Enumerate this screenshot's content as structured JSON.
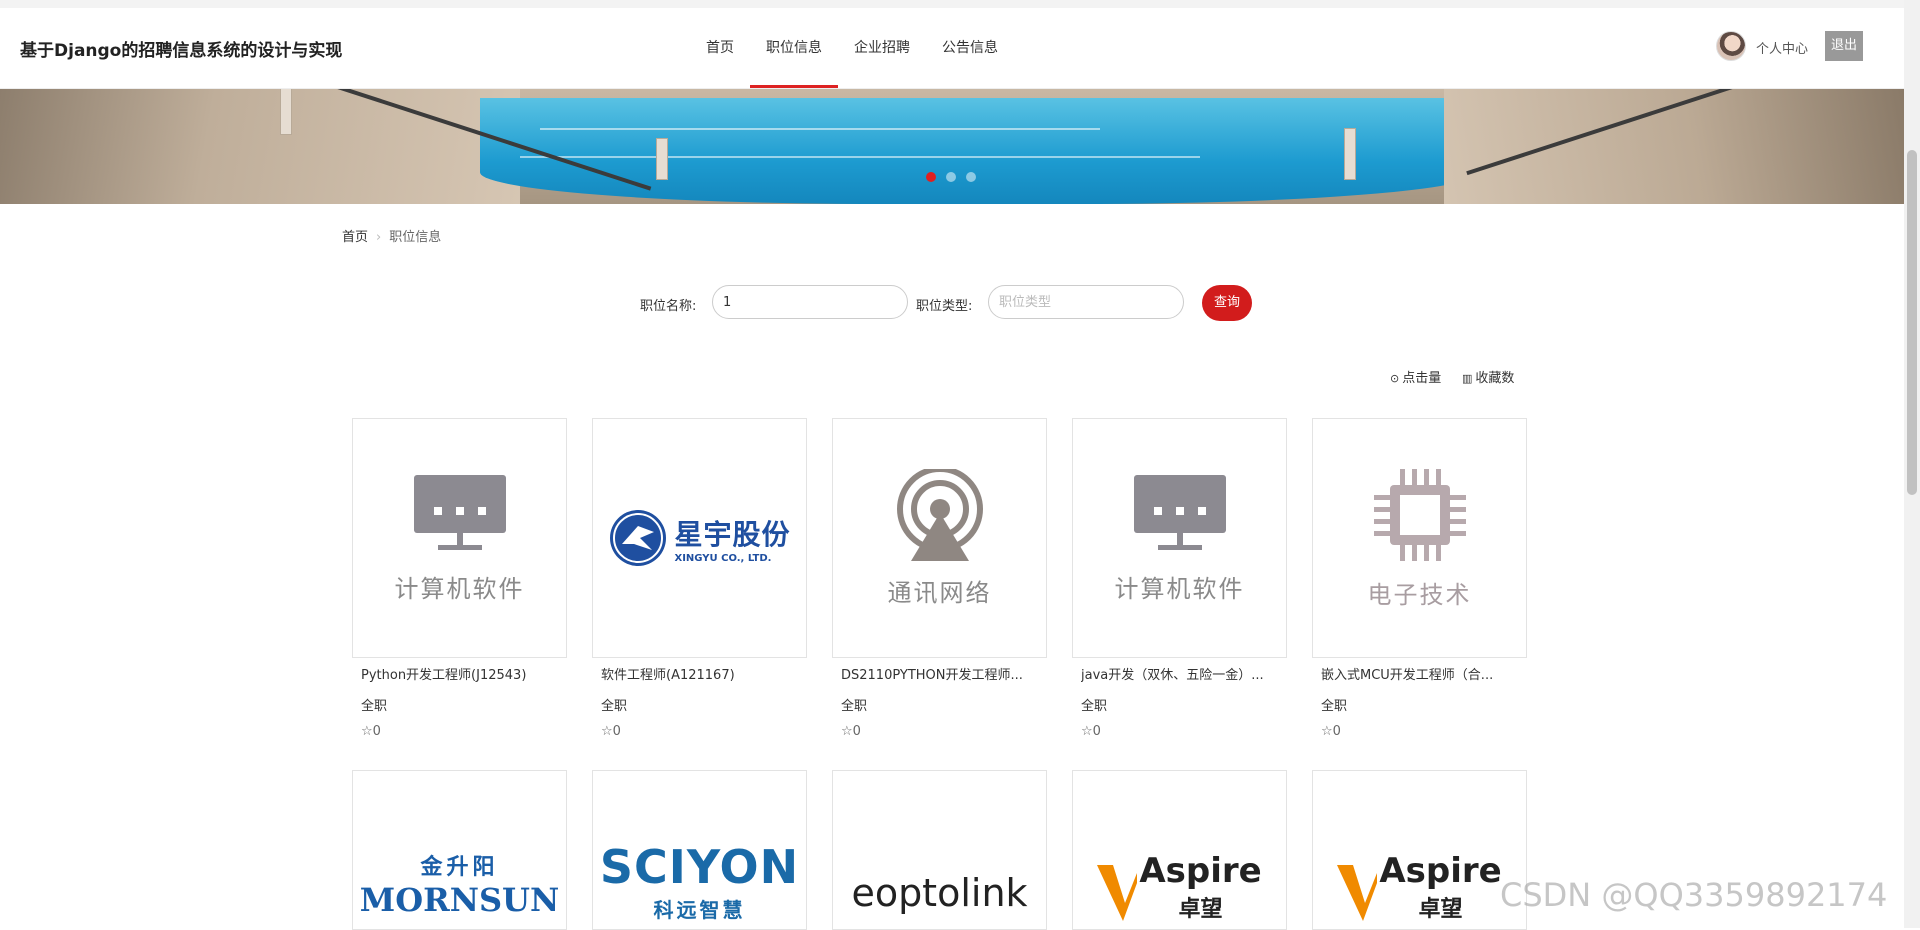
{
  "header": {
    "site_title": "基于Django的招聘信息系统的设计与实现",
    "nav": [
      "首页",
      "职位信息",
      "企业招聘",
      "公告信息"
    ],
    "active_nav": "职位信息",
    "user_center": "个人中心",
    "logout": "退出"
  },
  "breadcrumb": {
    "home": "首页",
    "sep": "›",
    "current": "职位信息"
  },
  "search": {
    "name_label": "职位名称:",
    "name_value": "1",
    "type_label": "职位类型:",
    "type_placeholder": "职位类型",
    "button": "查询"
  },
  "sort": {
    "clicks": "点击量",
    "favorites": "收藏数"
  },
  "jobs": [
    {
      "title": "Python开发工程师(J12543)",
      "type": "全职",
      "favorites": "0",
      "image_label": "计算机软件",
      "icon": "monitor-icon"
    },
    {
      "title": "软件工程师(A121167)",
      "type": "全职",
      "favorites": "0",
      "image_label": "星宇股份",
      "image_sub": "XINGYU CO., LTD.",
      "icon": "xingyu-logo"
    },
    {
      "title": "DS2110PYTHON开发工程师...",
      "type": "全职",
      "favorites": "0",
      "image_label": "通讯网络",
      "icon": "signal-icon"
    },
    {
      "title": "java开发（双休、五险一金）...",
      "type": "全职",
      "favorites": "0",
      "image_label": "计算机软件",
      "icon": "monitor-icon"
    },
    {
      "title": "嵌入式MCU开发工程师（合...",
      "type": "全职",
      "favorites": "0",
      "image_label": "电子技术",
      "icon": "chip-icon"
    }
  ],
  "logos_row2": [
    {
      "top": "金升阳",
      "main": "MORNSUN",
      "icon": "mornsun-logo"
    },
    {
      "top": "SCIYON",
      "main": "科远智慧",
      "icon": "sciyon-logo"
    },
    {
      "main": "eoptolink",
      "icon": "eoptolink-logo"
    },
    {
      "main": "Aspire",
      "sub": "卓望",
      "icon": "aspire-logo"
    },
    {
      "main": "Aspire",
      "sub": "卓望",
      "icon": "aspire-logo"
    }
  ],
  "watermark": "CSDN @QQ3359892174",
  "colors": {
    "accent": "#d21c1c",
    "icon_gray": "#8c8a91"
  }
}
